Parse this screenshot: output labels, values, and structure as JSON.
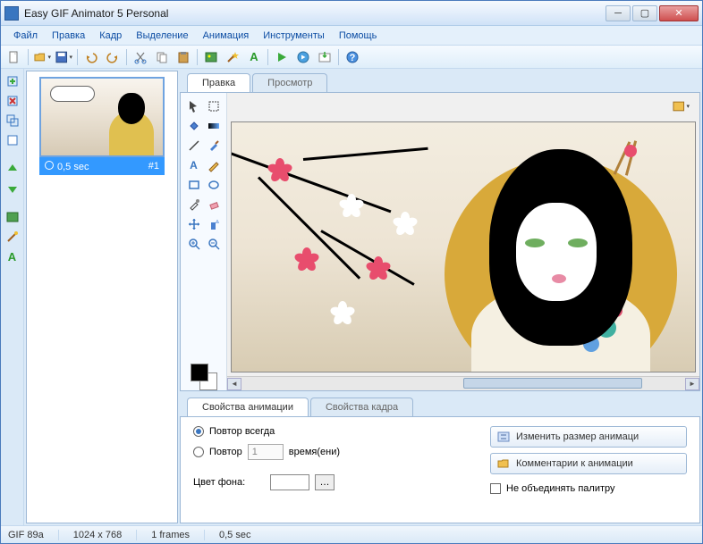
{
  "window": {
    "title": "Easy GIF Animator 5 Personal"
  },
  "menu": {
    "file": "Файл",
    "edit": "Правка",
    "frame": "Кадр",
    "selection": "Выделение",
    "animation": "Анимация",
    "tools": "Инструменты",
    "help": "Помощь"
  },
  "frame_list": {
    "items": [
      {
        "delay": "0,5 sec",
        "index": "#1"
      }
    ]
  },
  "tabs": {
    "edit": "Правка",
    "preview": "Просмотр"
  },
  "props_tabs": {
    "anim": "Свойства анимации",
    "frame": "Свойства кадра"
  },
  "props": {
    "repeat_always": "Повтор всегда",
    "repeat": "Повтор",
    "repeat_value": "1",
    "times": "время(ени)",
    "bgcolor": "Цвет фона:",
    "resize": "Изменить размер анимаци",
    "comments": "Комментарии к анимации",
    "merge_palette": "Не объединять палитру"
  },
  "status": {
    "format": "GIF 89a",
    "dims": "1024 x 768",
    "frames": "1 frames",
    "delay": "0,5 sec"
  },
  "icons": {
    "new": "new",
    "open": "open",
    "save": "save",
    "undo": "undo",
    "redo": "redo",
    "cut": "cut",
    "copy": "copy",
    "paste": "paste",
    "pick": "pick",
    "wand": "wand",
    "text": "text",
    "play": "play",
    "preview": "preview",
    "export": "export",
    "help": "help"
  }
}
